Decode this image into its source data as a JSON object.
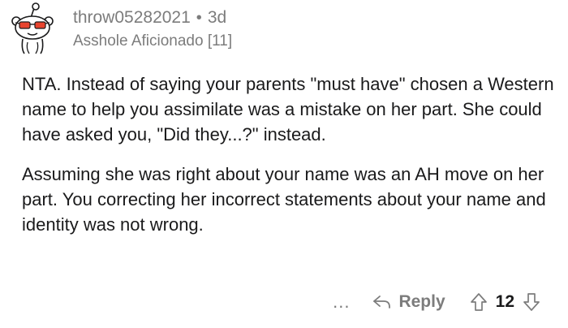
{
  "comment": {
    "username": "throw05282021",
    "separator": "•",
    "age": "3d",
    "flair": "Asshole Aficionado [11]",
    "paragraphs": [
      "NTA. Instead of saying your parents \"must have\" chosen a Western name to help you assimilate was a mistake on her part. She could have asked you, \"Did they...?\" instead.",
      "Assuming she was right about your name was an AH move on her part. You correcting her incorrect statements about your name and identity was not wrong."
    ]
  },
  "actions": {
    "more_label": "...",
    "reply_label": "Reply",
    "score": "12"
  },
  "icons": {
    "avatar": "snoo-sunglasses-avatar",
    "reply": "reply-arrow-icon",
    "upvote": "upvote-arrow-icon",
    "downvote": "downvote-arrow-icon"
  },
  "colors": {
    "text": "#1a1a1b",
    "meta": "#7c7c7c",
    "avatar_glasses": "#e8442e"
  }
}
